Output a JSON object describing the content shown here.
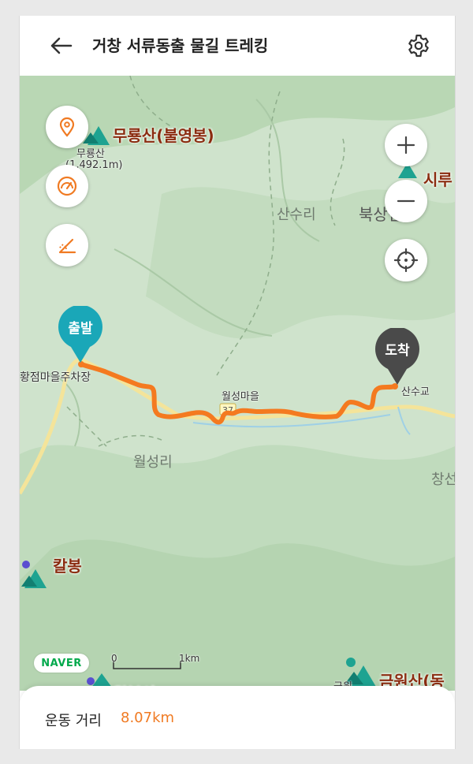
{
  "header": {
    "back_icon": "arrow-left-icon",
    "title": "거창 서류동출 물길 트레킹",
    "settings_icon": "gear-icon"
  },
  "map": {
    "controls": {
      "left": [
        "location-pin-icon",
        "speedometer-icon",
        "slope-icon"
      ],
      "right": [
        "zoom-in-icon",
        "zoom-out-icon",
        "crosshair-icon"
      ]
    },
    "labels": {
      "peak1": "무룡산(불영봉)",
      "peak1_sub": "무룡산",
      "peak1_elev": "(1,492.1m)",
      "peak_partial_right": "시루",
      "village_sansuri": "산수리",
      "village_buksang": "북상면",
      "village_wolseongri": "월성리",
      "village_changsan": "창선",
      "peak_kalbong": "칼봉",
      "peak_geumwon": "금원산(동",
      "peak_geumwon_sub": "금원",
      "peak_bottom_partial": "월봉산",
      "parking": "황점마을주차장",
      "wolseong_village": "월성마을",
      "road_number": "37",
      "sansugyo": "산수교"
    },
    "start_label": "출발",
    "end_label": "도착",
    "route_color": "#f47a20",
    "brand": "NAVER",
    "scale_start": "0",
    "scale_end": "1km"
  },
  "summary": {
    "distance_label": "운동 거리",
    "distance_value": "8.07km"
  }
}
